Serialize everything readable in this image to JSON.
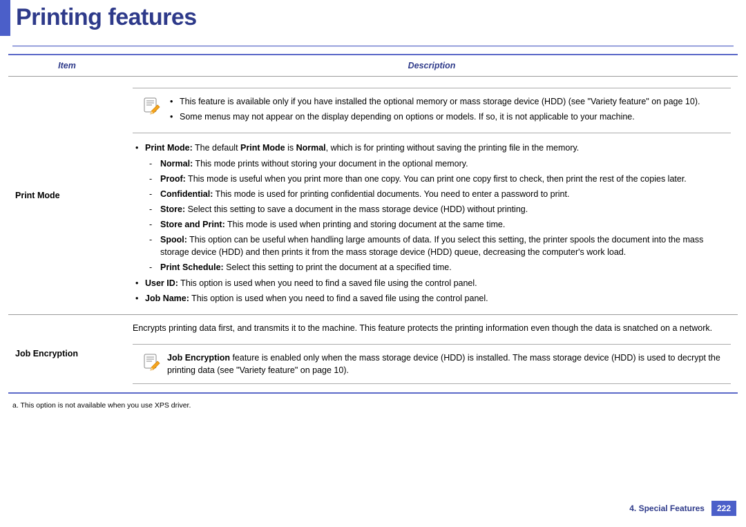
{
  "header": {
    "title": "Printing features"
  },
  "table": {
    "headers": {
      "item": "Item",
      "description": "Description"
    },
    "rows": {
      "printMode": {
        "label": "Print Mode",
        "noteBullets": [
          "This feature is available only if you have installed the optional memory or mass storage device (HDD) (see \"Variety feature\" on page 10).",
          "Some menus may not appear on the display depending on options or models. If so, it is not applicable to your machine."
        ],
        "modeLine": {
          "pre": "Print Mode:",
          "mid": " The default ",
          "bold2": "Print Mode",
          "mid2": " is ",
          "bold3": "Normal",
          "post": ", which is for printing without saving the printing file in the memory."
        },
        "subModes": [
          {
            "name": "Normal:",
            "text": " This mode prints without storing your document in the optional memory."
          },
          {
            "name": "Proof:",
            "text": " This mode is useful when you print more than one copy. You can print one copy first to check, then print the rest of the copies later."
          },
          {
            "name": "Confidential:",
            "text": " This mode is used for printing confidential documents. You need to enter a password to print."
          },
          {
            "name": "Store:",
            "text": " Select this setting to save a document in the mass storage device (HDD) without printing."
          },
          {
            "name": "Store and Print:",
            "text": " This mode is used when printing and storing document at the same time."
          },
          {
            "name": "Spool:",
            "text": " This option can be useful when handling large amounts of data. If you select this setting, the printer spools the document into the mass storage device (HDD) and then prints it from the mass storage device (HDD) queue, decreasing the computer's work load."
          },
          {
            "name": "Print Schedule:",
            "text": " Select this setting to print the document at a specified time."
          }
        ],
        "tailBullets": [
          {
            "name": "User ID:",
            "text": " This option is used when you need to find a saved file using the control panel."
          },
          {
            "name": "Job Name:",
            "text": " This option is used when you need to find a saved file using the control panel."
          }
        ]
      },
      "jobEncryption": {
        "label": "Job Encryption",
        "intro": "Encrypts printing data first, and transmits it to the machine. This feature protects the printing information even though the data is snatched on a network.",
        "note": {
          "bold": "Job Encryption",
          "text": " feature is enabled only when the mass storage device (HDD) is installed. The mass storage device (HDD) is used to decrypt the printing data (see \"Variety feature\" on page 10)."
        }
      }
    }
  },
  "footnote": "a.  This option is not available when you use XPS driver.",
  "footer": {
    "chapter": "4.  Special Features",
    "page": "222"
  }
}
